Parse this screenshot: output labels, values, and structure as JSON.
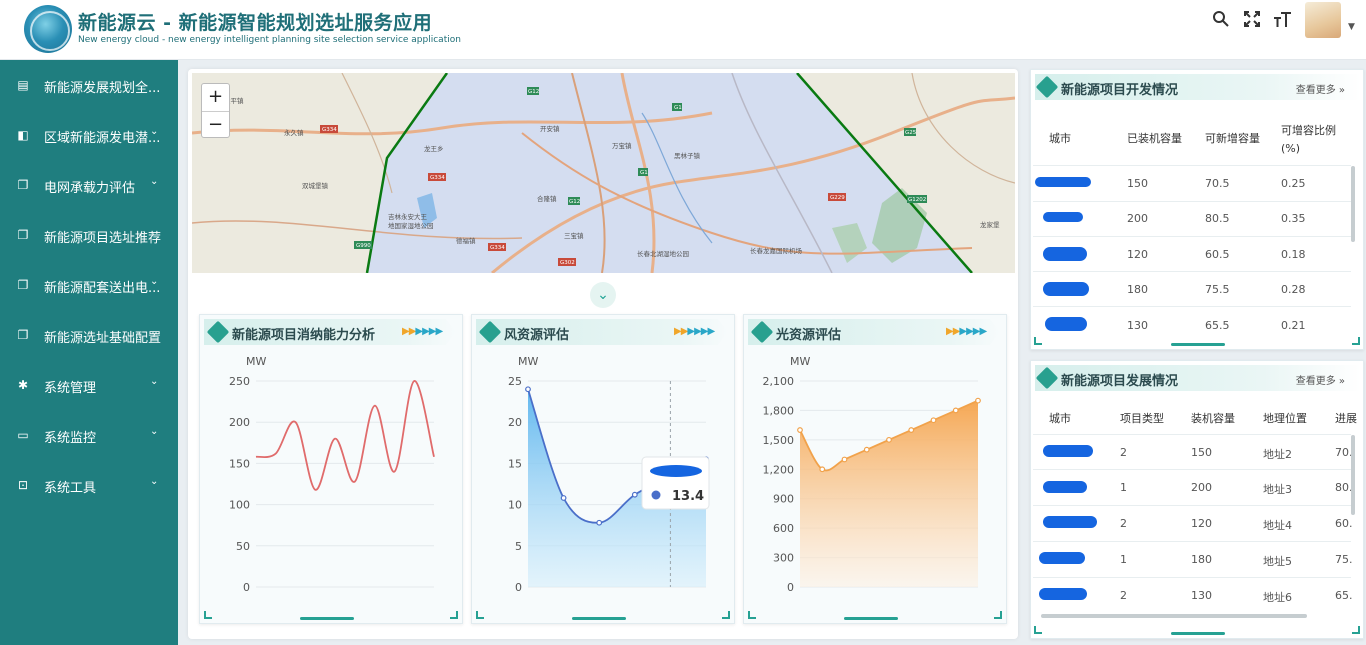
{
  "header": {
    "title": "新能源云 - 新能源智能规划选址服务应用",
    "subtitle": "New energy cloud - new energy intelligent planning site selection service application",
    "icons": [
      "search-icon",
      "fullscreen-icon",
      "font-size-icon",
      "avatar",
      "chevron-down-icon"
    ]
  },
  "sidebar": {
    "items": [
      {
        "label": "新能源发展规划全...",
        "icon": "document-icon",
        "expandable": false
      },
      {
        "label": "区域新能源发电潜...",
        "icon": "book-icon",
        "expandable": true
      },
      {
        "label": "电网承载力评估",
        "icon": "copy-icon",
        "expandable": true
      },
      {
        "label": "新能源项目选址推荐",
        "icon": "copy-icon",
        "expandable": false
      },
      {
        "label": "新能源配套送出电...",
        "icon": "copy-icon",
        "expandable": true
      },
      {
        "label": "新能源选址基础配置",
        "icon": "copy-icon",
        "expandable": false
      },
      {
        "label": "系统管理",
        "icon": "gear-icon",
        "expandable": true
      },
      {
        "label": "系统监控",
        "icon": "monitor-icon",
        "expandable": true
      },
      {
        "label": "系统工具",
        "icon": "toolbox-icon",
        "expandable": true
      }
    ]
  },
  "map": {
    "zoom_in": "+",
    "zoom_out": "−",
    "labels": [
      "太平镇",
      "永久镇",
      "双城堡镇",
      "龙王乡",
      "开安镇",
      "万宝镇",
      "合隆镇",
      "三宝镇",
      "黑林子镇",
      "吉林永安大王地国家湿地公园",
      "长春北湖湿地公园",
      "长春龙嘉国际机场",
      "万宝镇",
      "龙家堡",
      "G334",
      "G12",
      "G1",
      "G302",
      "G229",
      "G1202",
      "G990",
      "G25",
      "G302"
    ]
  },
  "cards": [
    {
      "title": "新能源项目消纳能力分析",
      "unit": "MW"
    },
    {
      "title": "风资源评估",
      "unit": "MW",
      "tooltip_value": "13.4"
    },
    {
      "title": "光资源评估",
      "unit": "MW"
    }
  ],
  "chart_data": [
    {
      "type": "line",
      "title": "新能源项目消纳能力分析",
      "ylabel": "MW",
      "ylim": [
        0,
        250
      ],
      "yticks": [
        "0",
        "50",
        "100",
        "150",
        "200",
        "250"
      ],
      "values": [
        158,
        162,
        200,
        118,
        180,
        128,
        220,
        140,
        250,
        158
      ],
      "color": "#e06b6b"
    },
    {
      "type": "area",
      "title": "风资源评估",
      "ylabel": "MW",
      "ylim": [
        0,
        25
      ],
      "yticks": [
        "0",
        "5",
        "10",
        "15",
        "20",
        "25"
      ],
      "values": [
        24,
        10.8,
        7.8,
        11.2,
        13.4,
        15.5
      ],
      "color": "#4a6fc9",
      "tooltip": {
        "index": 4,
        "value": "13.4"
      }
    },
    {
      "type": "area",
      "title": "光资源评估",
      "ylabel": "MW",
      "ylim": [
        0,
        2100
      ],
      "yticks": [
        "0",
        "300",
        "600",
        "900",
        "1,200",
        "1,500",
        "1,800",
        "2,100"
      ],
      "values": [
        1600,
        1200,
        1300,
        1400,
        1500,
        1600,
        1700,
        1800,
        1900
      ],
      "color": "#f1a24b"
    }
  ],
  "dev_status": {
    "title": "新能源项目开发情况",
    "more": "查看更多",
    "columns": [
      "城市",
      "已装机容量",
      "可新增容量",
      "可增容比例(%)"
    ],
    "rows": [
      {
        "cap": "150",
        "add": "70.5",
        "ratio": "0.25"
      },
      {
        "cap": "200",
        "add": "80.5",
        "ratio": "0.35"
      },
      {
        "cap": "120",
        "add": "60.5",
        "ratio": "0.18"
      },
      {
        "cap": "180",
        "add": "75.5",
        "ratio": "0.28"
      },
      {
        "cap": "130",
        "add": "65.5",
        "ratio": "0.21"
      }
    ]
  },
  "dev_progress": {
    "title": "新能源项目发展情况",
    "more": "查看更多",
    "columns": [
      "城市",
      "项目类型",
      "装机容量",
      "地理位置",
      "进展"
    ],
    "rows": [
      {
        "type": "2",
        "cap": "150",
        "loc": "地址2",
        "prog": "70."
      },
      {
        "type": "1",
        "cap": "200",
        "loc": "地址3",
        "prog": "80."
      },
      {
        "type": "2",
        "cap": "120",
        "loc": "地址4",
        "prog": "60."
      },
      {
        "type": "1",
        "cap": "180",
        "loc": "地址5",
        "prog": "75."
      },
      {
        "type": "2",
        "cap": "130",
        "loc": "地址6",
        "prog": "65."
      }
    ]
  }
}
